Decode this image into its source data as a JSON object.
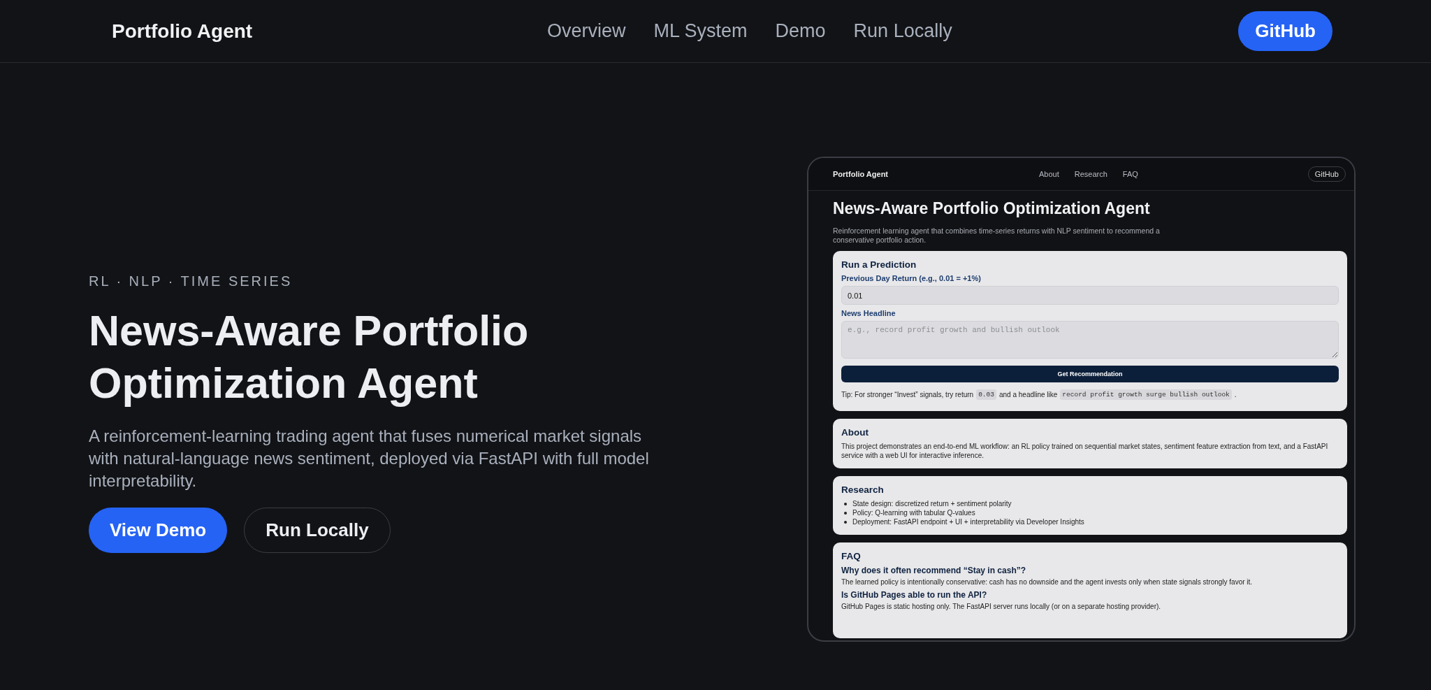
{
  "header": {
    "brand": "Portfolio Agent",
    "nav": [
      "Overview",
      "ML System",
      "Demo",
      "Run Locally"
    ],
    "github": "GitHub"
  },
  "hero": {
    "eyebrow": "RL · NLP · TIME SERIES",
    "title": "News-Aware Portfolio Optimization Agent",
    "description": "A reinforcement-learning trading agent that fuses numerical market signals with natural-language news sentiment, deployed via FastAPI with full model interpretability.",
    "buttons": [
      {
        "label": "View Demo",
        "kind": "primary"
      },
      {
        "label": "Run Locally",
        "kind": "outline"
      }
    ]
  },
  "preview": {
    "header": {
      "brand": "Portfolio Agent",
      "nav": [
        "About",
        "Research",
        "FAQ"
      ],
      "github": "GitHub"
    },
    "title": "News-Aware Portfolio Optimization Agent",
    "subtitle": "Reinforcement learning agent that combines time-series returns with NLP sentiment to recommend a conservative portfolio action.",
    "prediction": {
      "heading": "Run a Prediction",
      "return_label": "Previous Day Return (e.g., 0.01 = +1%)",
      "return_value": "0.01",
      "headline_label": "News Headline",
      "headline_placeholder": "e.g., record profit growth and bullish outlook",
      "button": "Get Recommendation",
      "tip": [
        {
          "kind": "text",
          "text": "Tip: For stronger “Invest” signals, try return"
        },
        {
          "kind": "code",
          "text": "0.03"
        },
        {
          "kind": "text",
          "text": "and a headline like"
        },
        {
          "kind": "code",
          "text": "record profit growth surge bullish outlook"
        },
        {
          "kind": "text",
          "text": "."
        }
      ]
    },
    "about": {
      "heading": "About",
      "text": "This project demonstrates an end-to-end ML workflow: an RL policy trained on sequential market states, sentiment feature extraction from text, and a FastAPI service with a web UI for interactive inference."
    },
    "research": {
      "heading": "Research",
      "items": [
        "State design: discretized return + sentiment polarity",
        "Policy: Q-learning with tabular Q-values",
        "Deployment: FastAPI endpoint + UI + interpretability via Developer Insights"
      ]
    },
    "faq": {
      "heading": "FAQ",
      "items": [
        {
          "question": "Why does it often recommend “Stay in cash”?",
          "answer": "The learned policy is intentionally conservative: cash has no downside and the agent invests only when state signals strongly favor it."
        },
        {
          "question": "Is GitHub Pages able to run the API?",
          "answer": "GitHub Pages is static hosting only. The FastAPI server runs locally (or on a separate hosting provider)."
        }
      ]
    }
  }
}
